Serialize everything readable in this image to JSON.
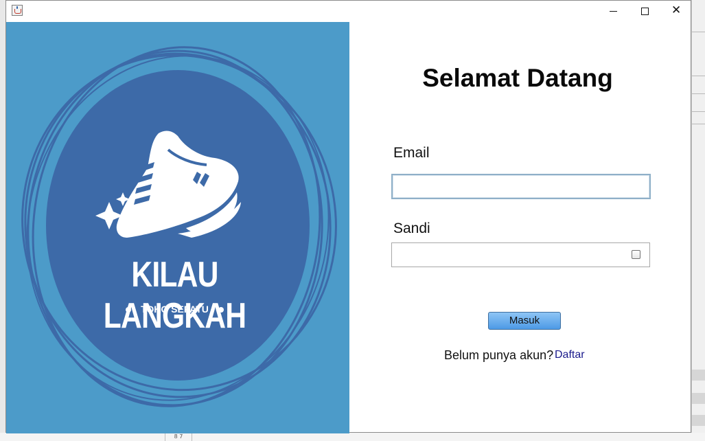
{
  "window": {
    "minimize_symbol": "",
    "maximize_symbol": "",
    "close_symbol": "✕"
  },
  "brand": {
    "name": "KILAU LANGKAH",
    "tagline": "TOKO SEPATU",
    "panel_color": "#4c9bc9",
    "circle_color": "#3d6aa8",
    "logo_icon": "sneaker-icon"
  },
  "login": {
    "heading": "Selamat Datang",
    "email_label": "Email",
    "email_value": "",
    "password_label": "Sandi",
    "password_value": "",
    "submit_label": "Masuk",
    "signup_question": "Belum punya akun?",
    "signup_link": "Daftar",
    "button_color": "#5ea8ec",
    "link_color": "#1a1a8c"
  },
  "background": {
    "footer_cell": "8 7"
  }
}
